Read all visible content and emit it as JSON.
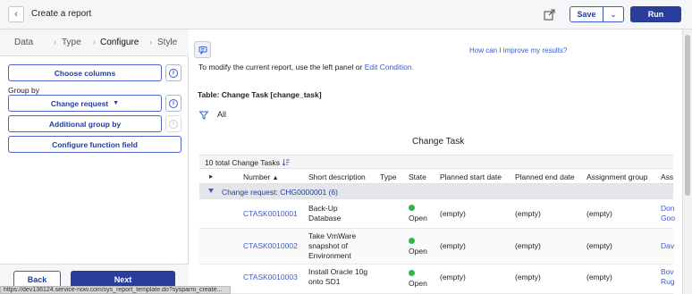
{
  "header": {
    "title": "Create a report",
    "save_label": "Save",
    "run_label": "Run"
  },
  "steps": [
    {
      "label": "Data"
    },
    {
      "label": "Type"
    },
    {
      "label": "Configure"
    },
    {
      "label": "Style"
    }
  ],
  "left_panel": {
    "choose_columns": "Choose columns",
    "group_by_label": "Group by",
    "group_by_value": "Change request",
    "additional_group": "Additional group by",
    "configure_function": "Configure function field",
    "back_label": "Back",
    "next_label": "Next"
  },
  "status_url": "https://dev136124.service-now.com/sys_report_template.do?sysparm_create...",
  "main": {
    "improve_link": "How can I improve my results?",
    "modify_text": "To modify the current report, use the left panel or ",
    "edit_condition": "Edit Condition.",
    "table_label": "Table: Change Task [change_task]",
    "filter_text": "All",
    "chart_title": "Change Task",
    "totals_text": "10 total Change Tasks",
    "columns": [
      "Number",
      "Short description",
      "Type",
      "State",
      "Planned start date",
      "Planned end date",
      "Assignment group",
      "Ass"
    ],
    "group_row": "Change request: CHG0000001 (6)",
    "rows": [
      {
        "number": "CTASK0010001",
        "desc": [
          "Back-Up",
          "Database"
        ],
        "state": "Open",
        "start": "(empty)",
        "end": "(empty)",
        "group": "(empty)",
        "assigned": [
          "Don",
          "Goo"
        ]
      },
      {
        "number": "CTASK0010002",
        "desc": [
          "Take VmWare",
          "snapshot of",
          "Environment"
        ],
        "state": "Open",
        "start": "(empty)",
        "end": "(empty)",
        "group": "(empty)",
        "assigned": [
          "Dav"
        ]
      },
      {
        "number": "CTASK0010003",
        "desc": [
          "Install Oracle 10g",
          "onto SD1"
        ],
        "state": "Open",
        "start": "(empty)",
        "end": "(empty)",
        "group": "(empty)",
        "assigned": [
          "Bov",
          "Rug"
        ]
      }
    ]
  },
  "colors": {
    "accent": "#293e9a",
    "link": "#3b5ccc",
    "state_open": "#2fb54a"
  }
}
